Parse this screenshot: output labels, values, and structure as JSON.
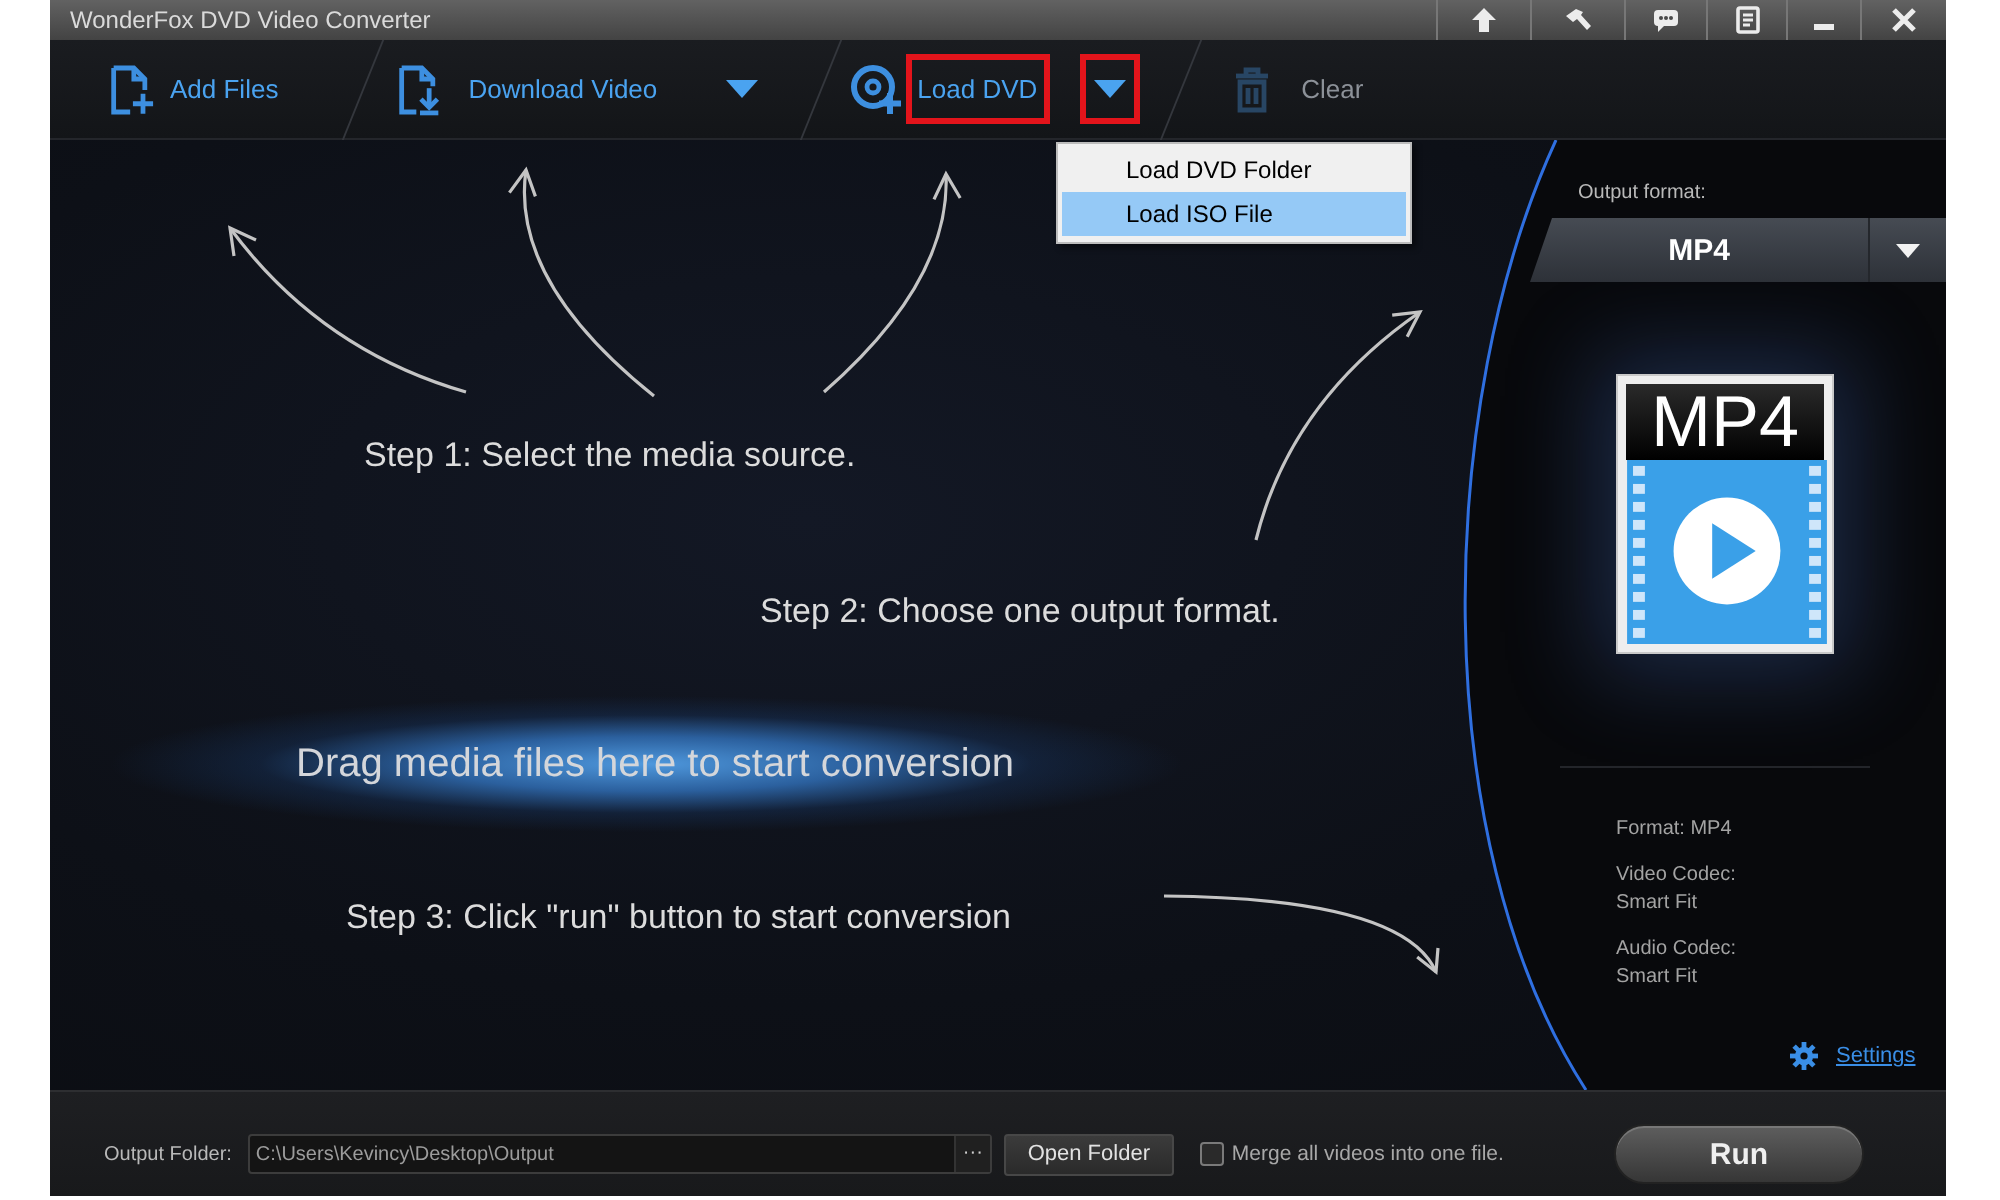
{
  "window": {
    "title": "WonderFox DVD Video Converter"
  },
  "toolbar": {
    "items": [
      {
        "kind": "add",
        "label": "Add Files",
        "highlighted": false,
        "disabled": false
      },
      {
        "kind": "download",
        "label": "Download Video",
        "highlighted": false,
        "disabled": false,
        "menu_button": {
          "highlighted": false
        }
      },
      {
        "kind": "disc",
        "label": "Load DVD",
        "highlighted": true,
        "disabled": false,
        "menu_button": {
          "highlighted": true
        }
      },
      {
        "kind": "trash",
        "label": "Clear",
        "highlighted": false,
        "disabled": true
      }
    ]
  },
  "dropdown_menu": {
    "items": [
      {
        "label": "Load DVD Folder",
        "selected": false
      },
      {
        "label": "Load ISO File",
        "selected": true
      }
    ]
  },
  "guide": {
    "step_1": "Step 1: Select the media source.",
    "step_2": "Step 2: Choose one output format.",
    "drop_hint": "Drag media files here to start conversion",
    "step_3": "Step 3: Click \"run\" button to start conversion"
  },
  "output_panel": {
    "label": "Output format:",
    "format": "MP4",
    "thumbnail_label": "MP4",
    "details": [
      {
        "label": "Format: MP4"
      },
      {
        "label": "Video Codec:",
        "value": "Smart Fit"
      },
      {
        "label": "Audio Codec:",
        "value": "Smart Fit"
      }
    ],
    "settings_link": "Settings"
  },
  "bottom_bar": {
    "output_folder_label": "Output Folder:",
    "output_path": "C:\\Users\\Kevincy\\Desktop\\Output",
    "browse_button": "···",
    "open_folder_button": "Open Folder",
    "merge": {
      "label": "Merge all videos into one file.",
      "checked": false
    },
    "run_button": "Run"
  }
}
